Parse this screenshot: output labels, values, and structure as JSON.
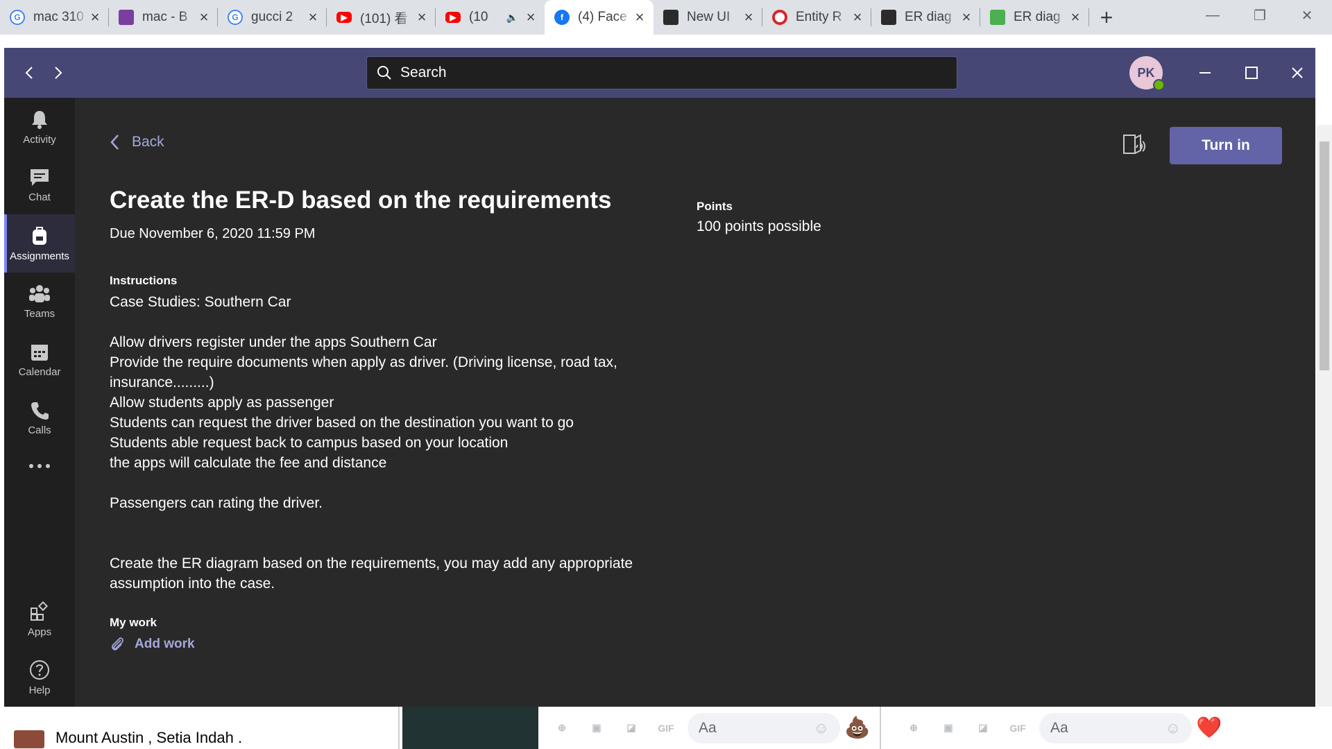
{
  "browser": {
    "tabs": [
      {
        "title": "mac 310",
        "favicon": "google-icon",
        "color": "#4285f4"
      },
      {
        "title": "mac - B",
        "favicon": "shop-icon",
        "color": "#7a3ea0"
      },
      {
        "title": "gucci 2",
        "favicon": "google-icon",
        "color": "#4285f4"
      },
      {
        "title": "(101) 看",
        "favicon": "youtube-icon",
        "color": "#ff0000"
      },
      {
        "title": "(10",
        "favicon": "youtube-icon",
        "color": "#ff0000"
      },
      {
        "title": "(4) Face",
        "favicon": "facebook-icon",
        "color": "#1877f2"
      },
      {
        "title": "New UI",
        "favicon": "ui-icon",
        "color": "#2b2b2b"
      },
      {
        "title": "Entity R",
        "favicon": "opera-icon",
        "color": "#d9252a"
      },
      {
        "title": "ER diag",
        "favicon": "er-icon",
        "color": "#2b2b2b"
      },
      {
        "title": "ER diag",
        "favicon": "er-image-icon",
        "color": "#4caf50"
      }
    ],
    "active_tab_index": 5
  },
  "teams": {
    "search_placeholder": "Search",
    "avatar_initials": "PK",
    "rail": [
      {
        "label": "Activity",
        "icon": "bell-icon"
      },
      {
        "label": "Chat",
        "icon": "chat-icon"
      },
      {
        "label": "Assignments",
        "icon": "backpack-icon"
      },
      {
        "label": "Teams",
        "icon": "teams-icon"
      },
      {
        "label": "Calendar",
        "icon": "calendar-icon"
      },
      {
        "label": "Calls",
        "icon": "phone-icon"
      },
      {
        "label": "Apps",
        "icon": "apps-icon"
      },
      {
        "label": "Help",
        "icon": "help-icon"
      }
    ],
    "active_rail": "Assignments",
    "accent": "#6264a7",
    "header_bg": "#464775"
  },
  "assignment": {
    "back_label": "Back",
    "turn_in_label": "Turn in",
    "title": "Create the ER-D based on the requirements",
    "due": "Due November 6, 2020 11:59 PM",
    "points_label": "Points",
    "points_value": "100 points possible",
    "instructions_label": "Instructions",
    "instructions": [
      "Case Studies: Southern Car",
      "",
      "Allow drivers register under the apps Southern Car",
      "Provide the require documents when apply as driver. (Driving license, road tax, insurance.........)",
      "Allow students apply as passenger",
      "Students can request the driver based on the destination you want to go",
      "Students able request back to campus based on your location",
      "the apps will calculate the fee and distance",
      "",
      "Passengers can rating the driver.",
      "",
      "",
      "Create the ER diagram based on the requirements, you may add any appropriate assumption into the case."
    ],
    "my_work_label": "My work",
    "add_work_label": "Add work"
  },
  "facebook_background": {
    "place": "Mount Austin , Setia Indah .",
    "chat_placeholder_1": "Aa",
    "chat_placeholder_2": "Aa",
    "gif_label": "GIF",
    "emoji_1": "💩",
    "emoji_2": "❤️"
  }
}
